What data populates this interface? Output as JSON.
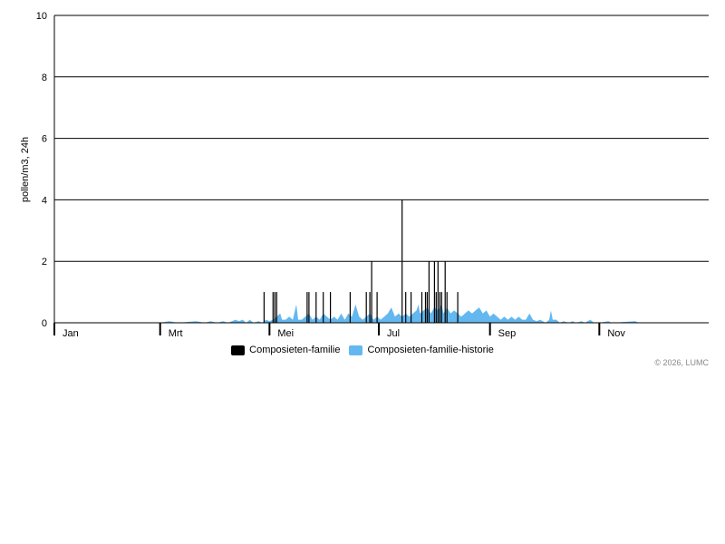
{
  "chart_data": {
    "type": "bar",
    "title": "",
    "ylabel": "pollen/m3, 24h",
    "xlabel": "",
    "ylim": [
      0,
      10
    ],
    "yticks": [
      0,
      2,
      4,
      6,
      8,
      10
    ],
    "xlim": [
      1,
      366
    ],
    "x_unit": "day of year",
    "month_labels": [
      {
        "label": "Jan",
        "day": 1
      },
      {
        "label": "Mrt",
        "day": 60
      },
      {
        "label": "Mei",
        "day": 121
      },
      {
        "label": "Jul",
        "day": 182
      },
      {
        "label": "Sep",
        "day": 244
      },
      {
        "label": "Nov",
        "day": 305
      }
    ],
    "grid": true,
    "legend_position": "bottom-center",
    "series": [
      {
        "name": "Composieten-familie",
        "color": "#000000",
        "type": "bar",
        "points": [
          [
            118,
            1
          ],
          [
            123,
            1
          ],
          [
            124,
            1
          ],
          [
            125,
            1
          ],
          [
            142,
            1
          ],
          [
            143,
            1
          ],
          [
            147,
            1
          ],
          [
            151,
            1
          ],
          [
            155,
            1
          ],
          [
            166,
            1
          ],
          [
            175,
            1
          ],
          [
            177,
            1
          ],
          [
            178,
            2
          ],
          [
            181,
            1
          ],
          [
            195,
            4
          ],
          [
            197,
            1
          ],
          [
            200,
            1
          ],
          [
            206,
            1
          ],
          [
            208,
            1
          ],
          [
            209,
            1
          ],
          [
            210,
            2
          ],
          [
            213,
            2
          ],
          [
            214,
            1
          ],
          [
            215,
            2
          ],
          [
            216,
            1
          ],
          [
            217,
            1
          ],
          [
            219,
            2
          ],
          [
            220,
            1
          ],
          [
            226,
            1
          ]
        ]
      },
      {
        "name": "Composieten-familie-historie",
        "color": "#63b8f0",
        "type": "area",
        "points": [
          [
            60,
            0
          ],
          [
            65,
            0.05
          ],
          [
            70,
            0
          ],
          [
            80,
            0.05
          ],
          [
            85,
            0
          ],
          [
            88,
            0.05
          ],
          [
            92,
            0
          ],
          [
            95,
            0.05
          ],
          [
            98,
            0
          ],
          [
            102,
            0.1
          ],
          [
            104,
            0.05
          ],
          [
            106,
            0.1
          ],
          [
            108,
            0
          ],
          [
            110,
            0.1
          ],
          [
            112,
            0
          ],
          [
            115,
            0.05
          ],
          [
            117,
            0
          ],
          [
            119,
            0.1
          ],
          [
            121,
            0.05
          ],
          [
            123,
            0.1
          ],
          [
            125,
            0.2
          ],
          [
            127,
            0.3
          ],
          [
            128,
            0.1
          ],
          [
            130,
            0.1
          ],
          [
            132,
            0.2
          ],
          [
            134,
            0.1
          ],
          [
            136,
            0.6
          ],
          [
            137,
            0.1
          ],
          [
            139,
            0.1
          ],
          [
            141,
            0.2
          ],
          [
            143,
            0.3
          ],
          [
            145,
            0.1
          ],
          [
            147,
            0.2
          ],
          [
            149,
            0.1
          ],
          [
            151,
            0.3
          ],
          [
            153,
            0.2
          ],
          [
            155,
            0.1
          ],
          [
            157,
            0.2
          ],
          [
            159,
            0.1
          ],
          [
            161,
            0.3
          ],
          [
            163,
            0.1
          ],
          [
            165,
            0.3
          ],
          [
            167,
            0.2
          ],
          [
            169,
            0.6
          ],
          [
            171,
            0.2
          ],
          [
            173,
            0.1
          ],
          [
            175,
            0.2
          ],
          [
            177,
            0.3
          ],
          [
            179,
            0.1
          ],
          [
            181,
            0.2
          ],
          [
            183,
            0.1
          ],
          [
            185,
            0.2
          ],
          [
            187,
            0.3
          ],
          [
            189,
            0.5
          ],
          [
            191,
            0.2
          ],
          [
            193,
            0.3
          ],
          [
            195,
            0.2
          ],
          [
            197,
            0.3
          ],
          [
            199,
            0.2
          ],
          [
            201,
            0.3
          ],
          [
            203,
            0.4
          ],
          [
            204,
            0.6
          ],
          [
            205,
            0.3
          ],
          [
            207,
            0.4
          ],
          [
            209,
            0.5
          ],
          [
            211,
            0.3
          ],
          [
            213,
            0.5
          ],
          [
            215,
            0.4
          ],
          [
            217,
            0.6
          ],
          [
            218,
            0.3
          ],
          [
            220,
            0.5
          ],
          [
            222,
            0.3
          ],
          [
            224,
            0.4
          ],
          [
            226,
            0.3
          ],
          [
            228,
            0.2
          ],
          [
            230,
            0.3
          ],
          [
            232,
            0.4
          ],
          [
            234,
            0.3
          ],
          [
            236,
            0.4
          ],
          [
            238,
            0.5
          ],
          [
            240,
            0.3
          ],
          [
            242,
            0.4
          ],
          [
            244,
            0.2
          ],
          [
            246,
            0.3
          ],
          [
            248,
            0.2
          ],
          [
            250,
            0.1
          ],
          [
            252,
            0.2
          ],
          [
            254,
            0.1
          ],
          [
            256,
            0.2
          ],
          [
            258,
            0.1
          ],
          [
            260,
            0.2
          ],
          [
            262,
            0.1
          ],
          [
            264,
            0.1
          ],
          [
            266,
            0.3
          ],
          [
            268,
            0.1
          ],
          [
            270,
            0.05
          ],
          [
            272,
            0.1
          ],
          [
            275,
            0
          ],
          [
            277,
            0.1
          ],
          [
            278,
            0.4
          ],
          [
            279,
            0.1
          ],
          [
            281,
            0.1
          ],
          [
            283,
            0
          ],
          [
            285,
            0.05
          ],
          [
            288,
            0
          ],
          [
            290,
            0.05
          ],
          [
            292,
            0
          ],
          [
            295,
            0.05
          ],
          [
            297,
            0
          ],
          [
            300,
            0.1
          ],
          [
            302,
            0
          ],
          [
            305,
            0
          ],
          [
            310,
            0.05
          ],
          [
            312,
            0
          ],
          [
            325,
            0.05
          ],
          [
            327,
            0
          ],
          [
            366,
            0
          ]
        ]
      }
    ],
    "credit": "© 2026, LUMC"
  }
}
